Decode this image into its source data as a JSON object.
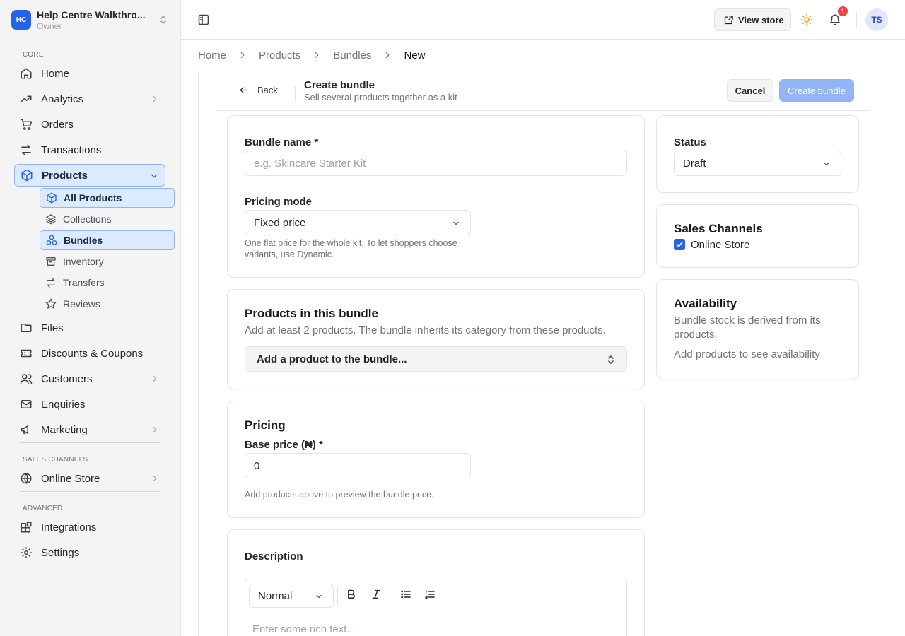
{
  "org": {
    "logo": "HC",
    "name": "Help Centre Walkthro...",
    "role": "Owner"
  },
  "sidebar": {
    "section_core": "CORE",
    "section_channels": "SALES CHANNELS",
    "section_advanced": "ADVANCED",
    "items": {
      "home": "Home",
      "analytics": "Analytics",
      "orders": "Orders",
      "transactions": "Transactions",
      "products": "Products",
      "files": "Files",
      "discounts": "Discounts & Coupons",
      "customers": "Customers",
      "enquiries": "Enquiries",
      "marketing": "Marketing",
      "online_store": "Online Store",
      "integrations": "Integrations",
      "settings": "Settings"
    },
    "sub_items": {
      "all_products": "All Products",
      "collections": "Collections",
      "bundles": "Bundles",
      "inventory": "Inventory",
      "transfers": "Transfers",
      "reviews": "Reviews"
    }
  },
  "topbar": {
    "view_store": "View store",
    "notification_count": "1",
    "avatar": "TS"
  },
  "breadcrumb": [
    "Home",
    "Products",
    "Bundles",
    "New"
  ],
  "header": {
    "back": "Back",
    "title": "Create bundle",
    "subtitle": "Sell several products together as a kit",
    "cancel": "Cancel",
    "create": "Create bundle"
  },
  "form": {
    "bundle_name_label": "Bundle name *",
    "bundle_name_placeholder": "e.g. Skincare Starter Kit",
    "pricing_mode_label": "Pricing mode",
    "pricing_mode_value": "Fixed price",
    "pricing_mode_help": "One flat price for the whole kit. To let shoppers choose variants, use Dynamic.",
    "products_title": "Products in this bundle",
    "products_desc": "Add at least 2 products. The bundle inherits its category from these products.",
    "products_picker": "Add a product to the bundle...",
    "pricing_title": "Pricing",
    "base_price_label": "Base price (₦) *",
    "base_price_value": "0",
    "pricing_help": "Add products above to preview the bundle price.",
    "description_label": "Description",
    "format_value": "Normal",
    "editor_placeholder": "Enter some rich text..."
  },
  "side": {
    "status_label": "Status",
    "status_value": "Draft",
    "channels_title": "Sales Channels",
    "channel_online_store": "Online Store",
    "channel_online_store_checked": true,
    "availability_title": "Availability",
    "availability_desc": "Bundle stock is derived from its products.",
    "availability_note": "Add products to see availability"
  },
  "colors": {
    "accent": "#2563eb",
    "accent_soft": "#dbeafe",
    "disabled_button": "#93b4f5",
    "badge": "#ef4444"
  }
}
